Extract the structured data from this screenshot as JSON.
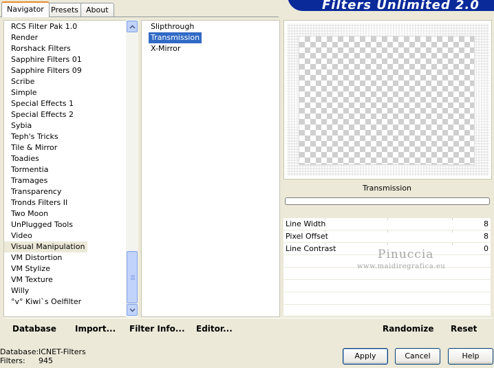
{
  "tabs": [
    {
      "label": "Navigator",
      "active": true
    },
    {
      "label": "Presets",
      "active": false
    },
    {
      "label": "About",
      "active": false
    }
  ],
  "app_title": "Filters Unlimited 2.0",
  "categories": [
    "RCS Filter Pak 1.0",
    "Render",
    "Rorshack Filters",
    "Sapphire Filters 01",
    "Sapphire Filters 09",
    "Scribe",
    "Simple",
    "Special Effects 1",
    "Special Effects 2",
    "Sybia",
    "Teph's Tricks",
    "Tile & Mirror",
    "Toadies",
    "Tormentia",
    "Tramages",
    "Transparency",
    "Tronds Filters II",
    "Two Moon",
    "UnPlugged Tools",
    "Video",
    "Visual Manipulation",
    "VM Distortion",
    "VM Stylize",
    "VM Texture",
    "Willy",
    "°v° Kiwi`s Oelfilter"
  ],
  "selected_category": "Visual Manipulation",
  "filters": [
    "Slipthrough",
    "Transmission",
    "X-Mirror"
  ],
  "selected_filter": "Transmission",
  "preview_filter_name": "Transmission",
  "params": [
    {
      "label": "Line Width",
      "value": "8"
    },
    {
      "label": "Pixel Offset",
      "value": "8"
    },
    {
      "label": "Line Contrast",
      "value": "0"
    }
  ],
  "watermark": {
    "title": "Pinuccia",
    "url": "www.maidiregrafica.eu"
  },
  "toolbar": {
    "database": "Database",
    "import": "Import...",
    "filter_info": "Filter Info...",
    "editor": "Editor...",
    "randomize": "Randomize",
    "reset": "Reset"
  },
  "status": {
    "database_label": "Database:",
    "database_value": "ICNET-Filters",
    "filters_label": "Filters:",
    "filters_value": "945"
  },
  "buttons": {
    "apply": "Apply",
    "cancel": "Cancel",
    "help": "Help"
  },
  "colors": {
    "selection": "#316ac5",
    "banner": "#0a2a9a",
    "window_bg": "#ece9d8"
  }
}
